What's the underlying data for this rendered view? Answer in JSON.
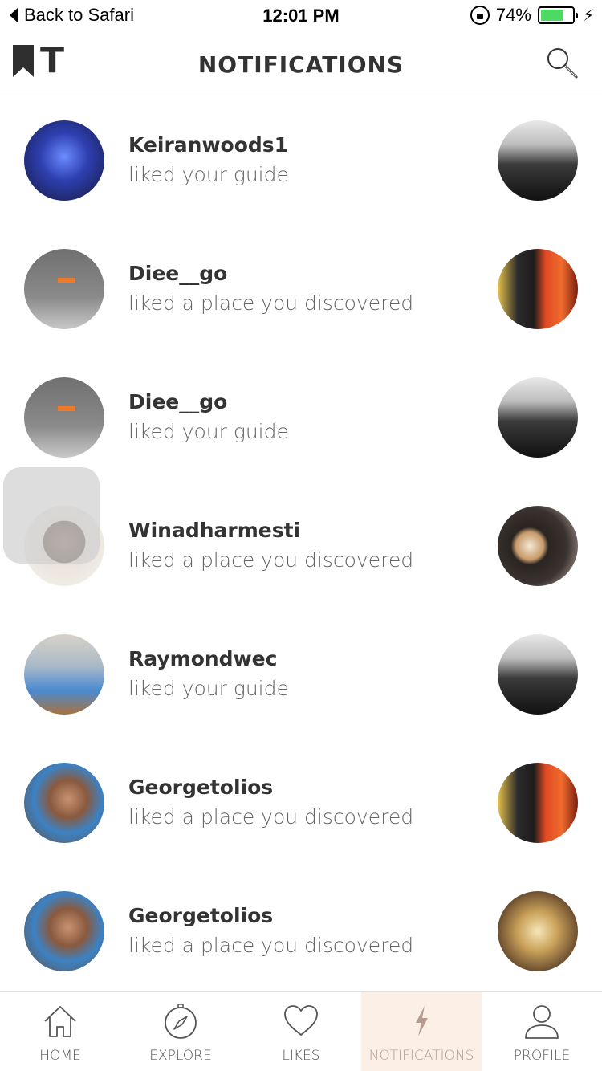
{
  "status_bar": {
    "back_label": "Back to Safari",
    "time": "12:01 PM",
    "battery": "74%",
    "battery_level": 0.74
  },
  "header": {
    "logo_text": "T",
    "title": "NOTIFICATIONS",
    "search_icon": "search-icon"
  },
  "notifications": [
    {
      "username": "Keiranwoods1",
      "action": "liked your guide"
    },
    {
      "username": "Diee__go",
      "action": "liked a place you discovered"
    },
    {
      "username": "Diee__go",
      "action": "liked your guide"
    },
    {
      "username": "Winadharmesti",
      "action": "liked a place you discovered"
    },
    {
      "username": "Raymondwec",
      "action": "liked your guide"
    },
    {
      "username": "Georgetolios",
      "action": "liked a place you discovered"
    },
    {
      "username": "Georgetolios",
      "action": "liked a place you discovered"
    }
  ],
  "tabs": [
    {
      "label": "HOME",
      "icon": "home-icon"
    },
    {
      "label": "EXPLORE",
      "icon": "compass-icon"
    },
    {
      "label": "LIKES",
      "icon": "heart-icon"
    },
    {
      "label": "NOTIFICATIONS",
      "icon": "bolt-icon"
    },
    {
      "label": "PROFILE",
      "icon": "profile-icon"
    }
  ],
  "colors": {
    "active_tab_bg": "#fcefe6",
    "active_tab_label": "#b49d8e",
    "battery_green": "#4cd964"
  }
}
